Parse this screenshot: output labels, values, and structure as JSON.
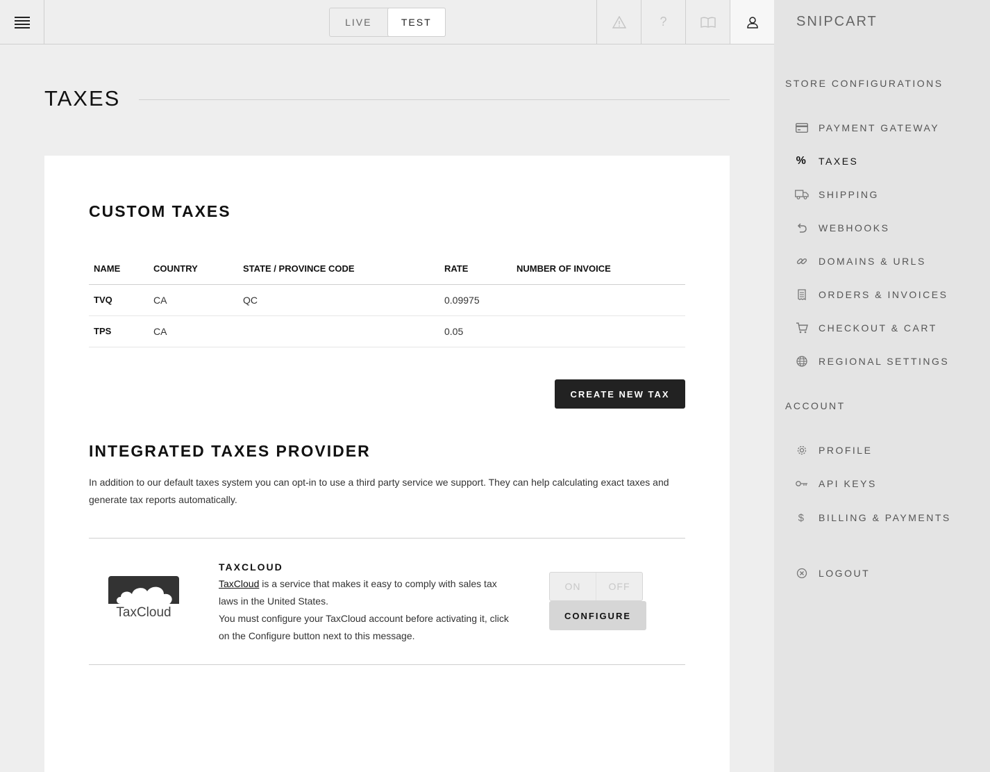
{
  "topbar": {
    "env": {
      "live_label": "LIVE",
      "test_label": "TEST",
      "active": "TEST"
    }
  },
  "sidebar": {
    "brand": "SNIPCART",
    "store_heading": "STORE CONFIGURATIONS",
    "store_items": [
      {
        "label": "PAYMENT GATEWAY",
        "icon": "credit-card-icon"
      },
      {
        "label": "TAXES",
        "icon": "percent-icon",
        "active": true
      },
      {
        "label": "SHIPPING",
        "icon": "truck-icon"
      },
      {
        "label": "WEBHOOKS",
        "icon": "undo-arrow-icon"
      },
      {
        "label": "DOMAINS & URLS",
        "icon": "link-icon"
      },
      {
        "label": "ORDERS & INVOICES",
        "icon": "receipt-icon"
      },
      {
        "label": "CHECKOUT & CART",
        "icon": "cart-icon"
      },
      {
        "label": "REGIONAL SETTINGS",
        "icon": "globe-icon"
      }
    ],
    "account_heading": "ACCOUNT",
    "account_items": [
      {
        "label": "PROFILE",
        "icon": "gear-icon"
      },
      {
        "label": "API KEYS",
        "icon": "key-icon"
      },
      {
        "label": "BILLING & PAYMENTS",
        "icon": "dollar-icon"
      }
    ],
    "logout": {
      "label": "LOGOUT",
      "icon": "close-circle-icon"
    }
  },
  "page": {
    "title": "TAXES"
  },
  "custom_taxes": {
    "title": "CUSTOM TAXES",
    "columns": [
      "NAME",
      "COUNTRY",
      "STATE / PROVINCE CODE",
      "RATE",
      "NUMBER OF INVOICE"
    ],
    "rows": [
      {
        "name": "TVQ",
        "country": "CA",
        "state": "QC",
        "rate": "0.09975",
        "invoices": ""
      },
      {
        "name": "TPS",
        "country": "CA",
        "state": "",
        "rate": "0.05",
        "invoices": ""
      }
    ],
    "create_button": "CREATE NEW TAX"
  },
  "integrated": {
    "title": "INTEGRATED TAXES PROVIDER",
    "intro": "In addition to our default taxes system you can opt-in to use a third party service we support. They can help calculating exact taxes and generate tax reports automatically.",
    "provider": {
      "name": "TAXCLOUD",
      "logo_text": "TaxCloud",
      "link_text": "TaxCloud",
      "desc_after_link": " is a service that makes it easy to comply with sales tax laws in the United States.",
      "note": "You must configure your TaxCloud account before activating it, click on the Configure button next to this message.",
      "on_label": "ON",
      "off_label": "OFF",
      "configure_button": "CONFIGURE"
    }
  }
}
